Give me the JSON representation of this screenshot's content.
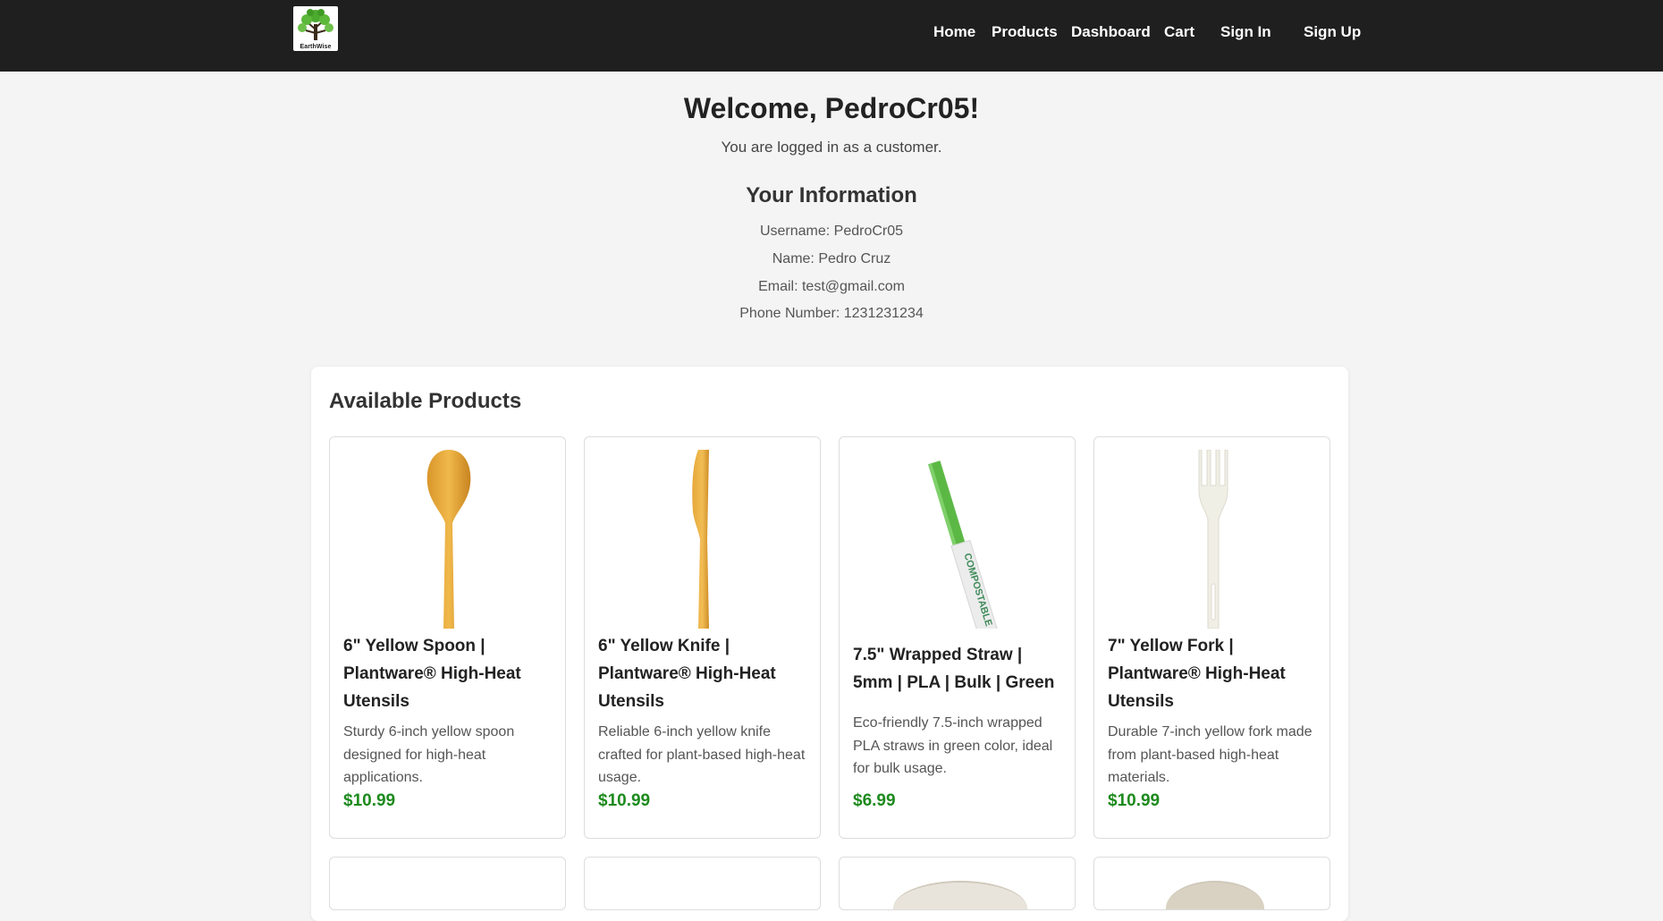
{
  "brand": {
    "logo_text": "EarthWise"
  },
  "nav": {
    "home": "Home",
    "products": "Products",
    "dashboard": "Dashboard",
    "cart": "Cart",
    "sign_in": "Sign In",
    "sign_up": "Sign Up"
  },
  "welcome": {
    "title": "Welcome, PedroCr05!",
    "subtitle": "You are logged in as a customer."
  },
  "info": {
    "title": "Your Information",
    "username": "Username: PedroCr05",
    "name": "Name: Pedro Cruz",
    "email": "Email: test@gmail.com",
    "phone": "Phone Number: 1231231234"
  },
  "products": {
    "title": "Available Products",
    "items": [
      {
        "name": "6\" Yellow Spoon | Plantware® High-Heat Utensils",
        "description": "Sturdy 6-inch yellow spoon designed for high-heat applications.",
        "price": "$10.99",
        "icon": "yellow-spoon-image"
      },
      {
        "name": "6\" Yellow Knife | Plantware® High-Heat Utensils",
        "description": "Reliable 6-inch yellow knife crafted for plant-based high-heat usage.",
        "price": "$10.99",
        "icon": "yellow-knife-image"
      },
      {
        "name": "7.5\" Wrapped Straw | 5mm | PLA | Bulk | Green",
        "description": "Eco-friendly 7.5-inch wrapped PLA straws in green color, ideal for bulk usage.",
        "price": "$6.99",
        "icon": "green-straw-image",
        "wrapper_text": "COMPOSTABLE"
      },
      {
        "name": "7\" Yellow Fork | Plantware® High-Heat Utensils",
        "description": "Durable 7-inch yellow fork made from plant-based high-heat materials.",
        "price": "$10.99",
        "icon": "fork-image"
      }
    ]
  },
  "colors": {
    "topbar": "#1f1f1f",
    "background": "#f4f4f4",
    "price": "#1d8a1d"
  }
}
